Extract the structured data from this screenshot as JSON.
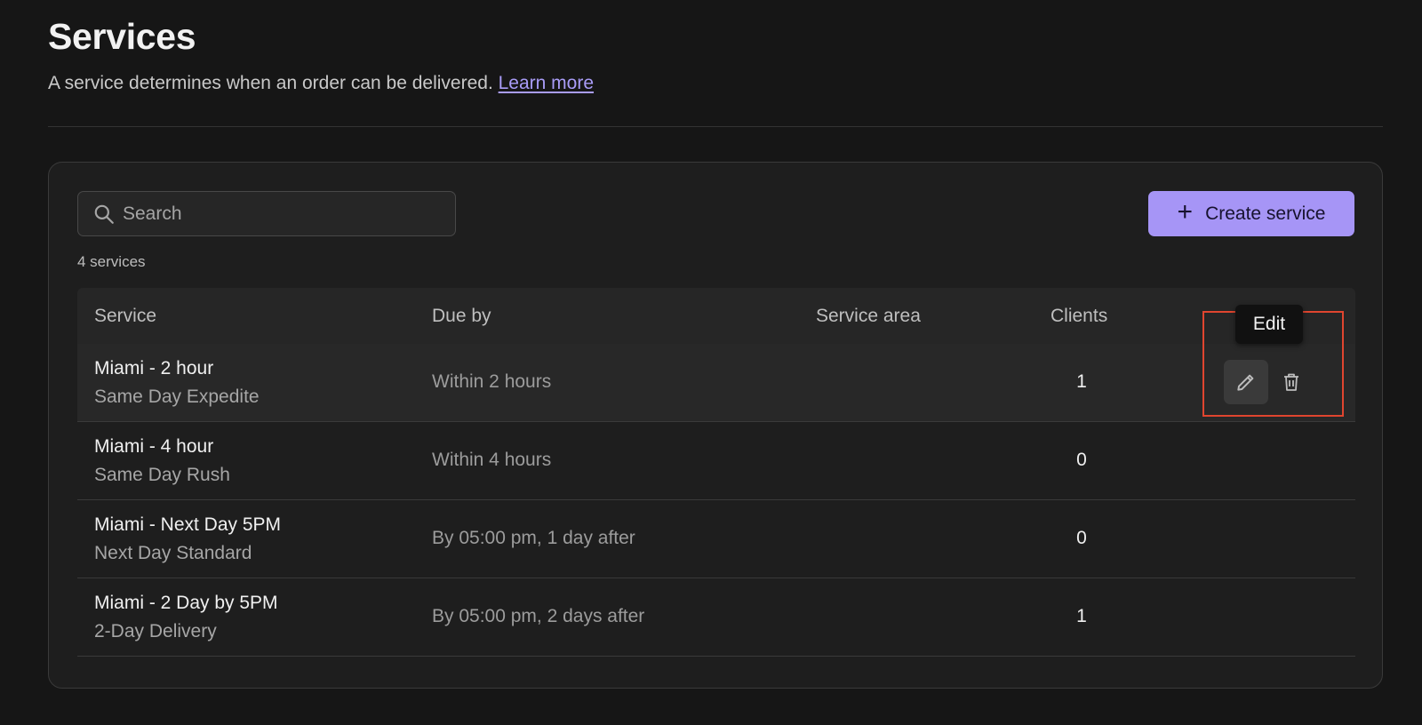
{
  "header": {
    "title": "Services",
    "subtitle": "A service determines when an order can be delivered.",
    "learn_more": "Learn more"
  },
  "toolbar": {
    "search_placeholder": "Search",
    "create_label": "Create service",
    "create_icon": "plus-icon"
  },
  "count_text": "4 services",
  "table": {
    "columns": [
      "Service",
      "Due by",
      "Service area",
      "Clients"
    ],
    "rows": [
      {
        "name": "Miami - 2 hour",
        "type": "Same Day Expedite",
        "due": "Within 2 hours",
        "area": "",
        "clients": "1"
      },
      {
        "name": "Miami - 4 hour",
        "type": "Same Day Rush",
        "due": "Within 4 hours",
        "area": "",
        "clients": "0"
      },
      {
        "name": "Miami - Next Day 5PM",
        "type": "Next Day Standard",
        "due": "By 05:00 pm, 1 day after",
        "area": "",
        "clients": "0"
      },
      {
        "name": "Miami - 2 Day by 5PM",
        "type": "2-Day Delivery",
        "due": "By 05:00 pm, 2 days after",
        "area": "",
        "clients": "1"
      }
    ]
  },
  "tooltip": {
    "label": "Edit"
  },
  "colors": {
    "background": "#161616",
    "card": "#1e1e1e",
    "accent": "#a695f6",
    "link": "#a99cf7",
    "highlight": "#e0452f"
  },
  "icons": {
    "search": "search-icon",
    "edit": "pencil-icon",
    "delete": "trash-icon"
  }
}
